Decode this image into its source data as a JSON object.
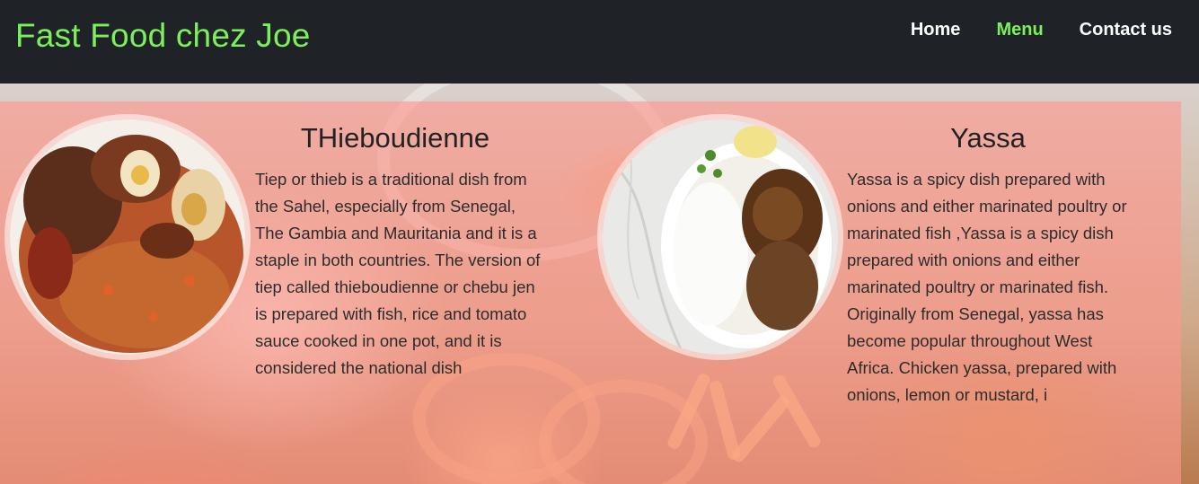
{
  "header": {
    "brand": "Fast Food chez Joe",
    "nav": [
      {
        "label": "Home",
        "active": false
      },
      {
        "label": "Menu",
        "active": true
      },
      {
        "label": "Contact us",
        "active": false
      }
    ]
  },
  "dishes": [
    {
      "title": "THieboudienne",
      "description": "Tiep or thieb is a traditional dish from the Sahel, especially from Senegal, The Gambia and Mauritania and it is a staple in both countries. The version of tiep called thieboudienne or chebu jen is prepared with fish, rice and tomato sauce cooked in one pot, and it is considered the national dish",
      "image": "thieboudienne-photo"
    },
    {
      "title": "Yassa",
      "description": "Yassa is a spicy dish prepared with onions and either marinated poultry or marinated fish ,Yassa is a spicy dish prepared with onions and either marinated poultry or marinated fish. Originally from Senegal, yassa has become popular throughout West Africa. Chicken yassa, prepared with onions, lemon or mustard, i",
      "image": "yassa-photo"
    }
  ],
  "colors": {
    "header_bg": "#1f2327",
    "brand": "#7cf05a",
    "nav_active": "#7cf05a",
    "overlay": "#ff968c"
  }
}
